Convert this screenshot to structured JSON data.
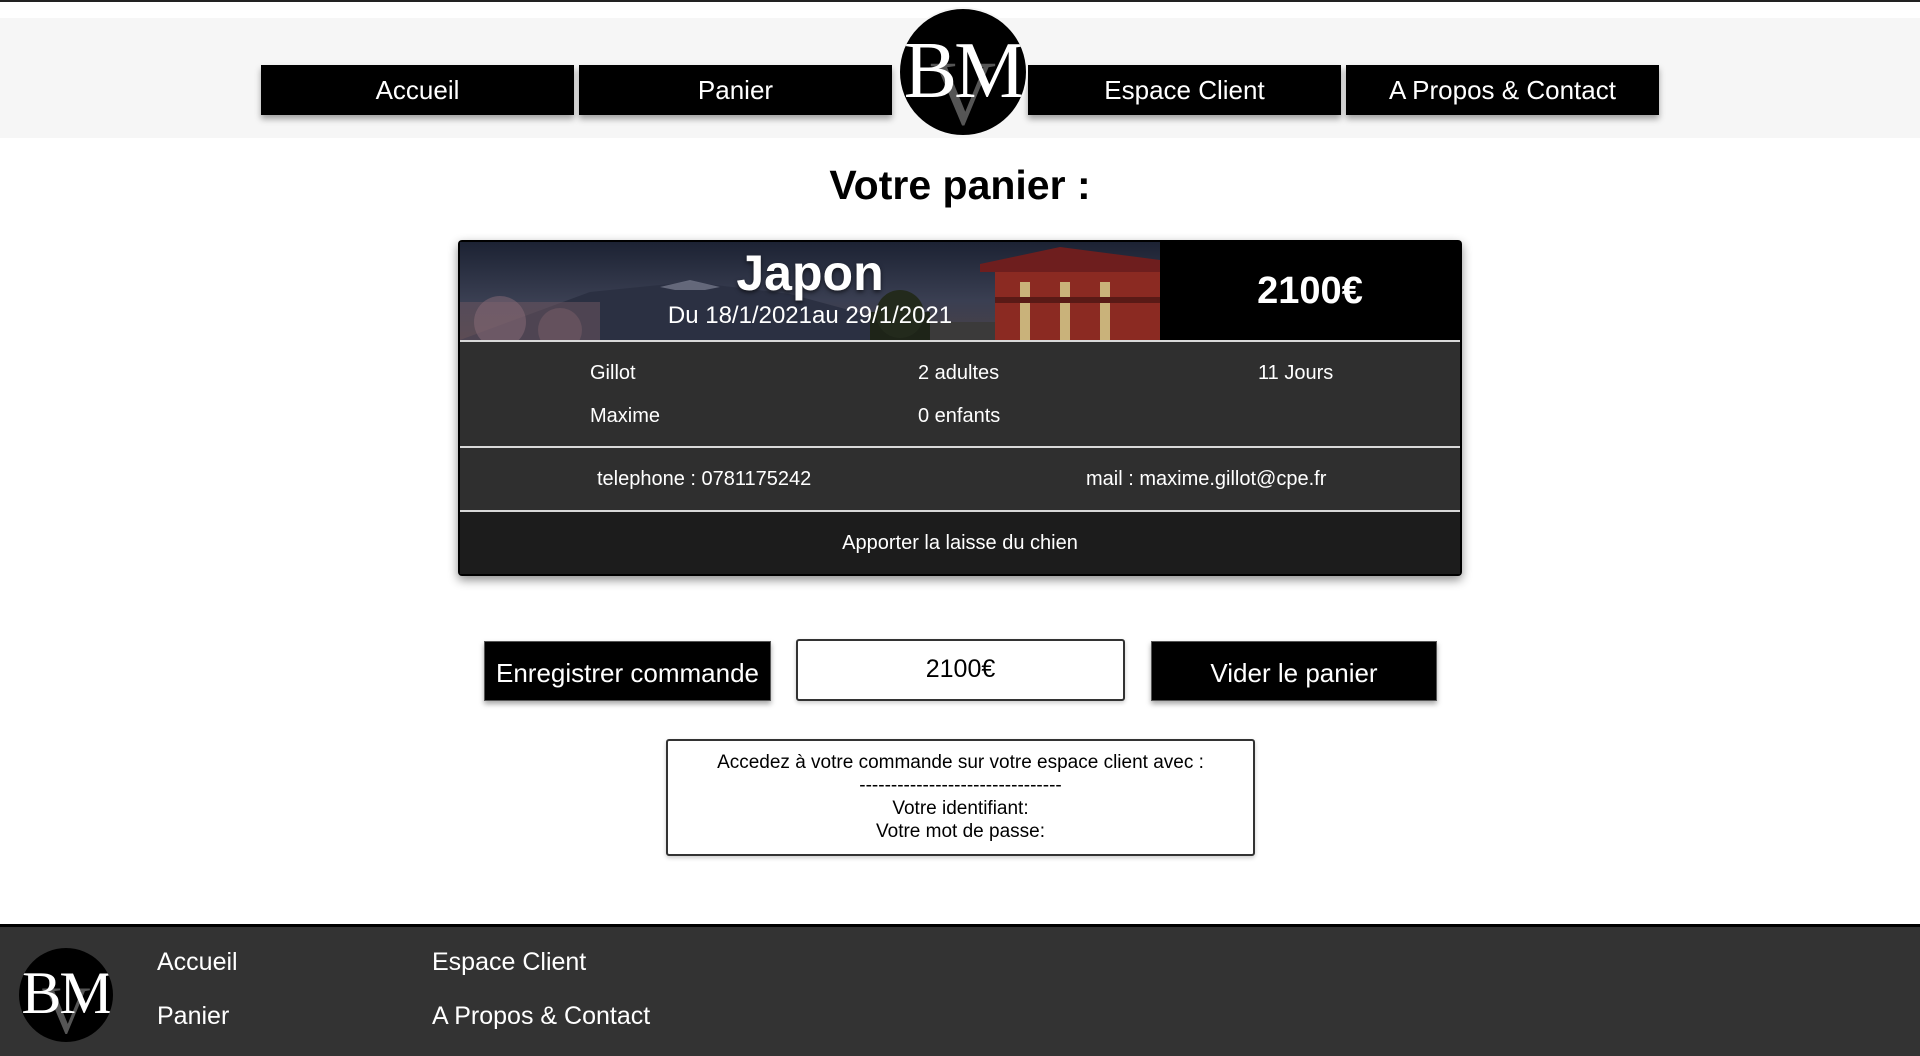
{
  "nav": {
    "items": [
      {
        "label": "Accueil"
      },
      {
        "label": "Panier"
      },
      {
        "label": "Espace Client"
      },
      {
        "label": "A Propos & Contact"
      }
    ],
    "logo": {
      "text": "BM",
      "sub": "V"
    }
  },
  "cart": {
    "title": "Votre panier :",
    "item": {
      "destination": "Japon",
      "dates": "Du 18/1/2021au 29/1/2021",
      "price": "2100€",
      "last_name": "Gillot",
      "first_name": "Maxime",
      "adults": "2 adultes",
      "children": "0 enfants",
      "duration": "11 Jours",
      "phone": "telephone : 0781175242",
      "email": "mail : maxime.gillot@cpe.fr",
      "note": "Apporter la laisse du chien"
    },
    "save_label": "Enregistrer commande",
    "total": "2100€",
    "empty_label": "Vider le panier"
  },
  "info": {
    "line1": "Accedez à votre commande sur votre espace client avec :",
    "line2": "--------------------------------",
    "line3": "Votre identifiant:",
    "line4": "Votre mot de passe:"
  },
  "footer": {
    "logo": {
      "text": "BM",
      "sub": "V"
    },
    "links": [
      {
        "label": "Accueil"
      },
      {
        "label": "Panier"
      },
      {
        "label": "Espace Client"
      },
      {
        "label": "A Propos & Contact"
      }
    ]
  }
}
